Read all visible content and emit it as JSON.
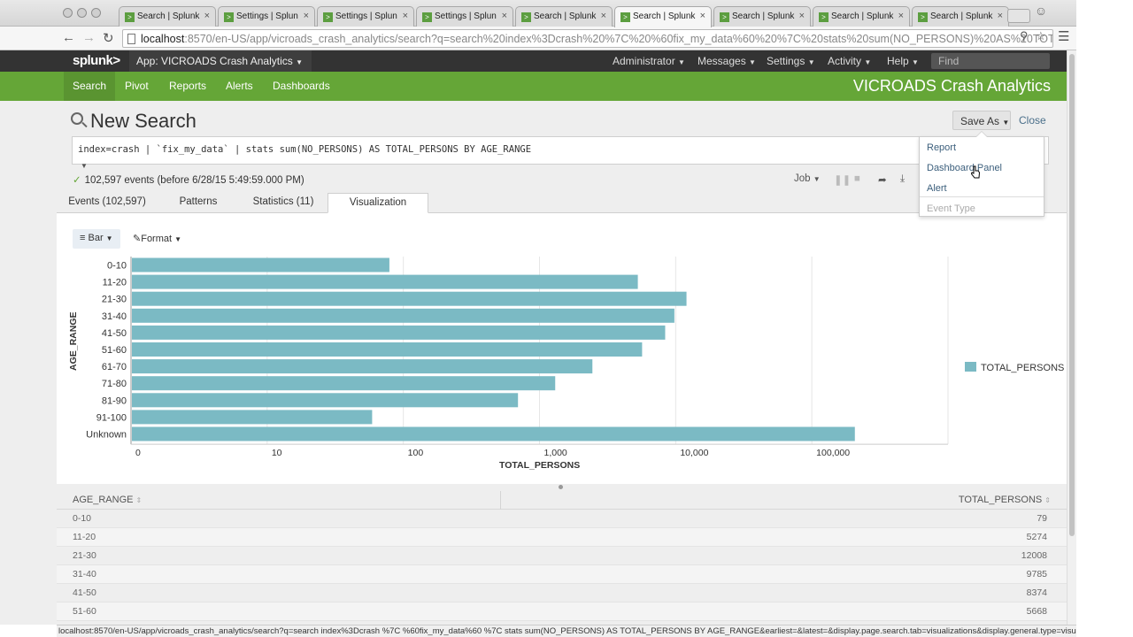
{
  "browser": {
    "tabs": [
      {
        "label": "Search | Splunk",
        "active": false
      },
      {
        "label": "Settings | Splun",
        "active": false
      },
      {
        "label": "Settings | Splun",
        "active": false
      },
      {
        "label": "Settings | Splun",
        "active": false
      },
      {
        "label": "Search | Splunk",
        "active": false
      },
      {
        "label": "Search | Splunk",
        "active": true
      },
      {
        "label": "Search | Splunk",
        "active": false
      },
      {
        "label": "Search | Splunk",
        "active": false
      },
      {
        "label": "Search | Splunk",
        "active": false
      }
    ],
    "tab_favicon": ">",
    "tab_close": "×",
    "url_host": "localhost",
    "url_rest": ":8570/en-US/app/vicroads_crash_analytics/search?q=search%20index%3Dcrash%20%7C%20%60fix_my_data%60%20%7C%20stats%20sum(NO_PERSONS)%20AS%20TOTAL_...",
    "status_url": "localhost:8570/en-US/app/vicroads_crash_analytics/search?q=search index%3Dcrash %7C %60fix_my_data%60 %7C stats sum(NO_PERSONS) AS TOTAL_PERSONS BY AGE_RANGE&earliest=&latest=&display.page.search.tab=visualizations&display.general.type=visualiz..."
  },
  "splunkbar": {
    "logo": "splunk>",
    "app_label": "App: VICROADS Crash Analytics",
    "items": [
      "Administrator",
      "Messages",
      "Settings",
      "Activity",
      "Help"
    ],
    "find_placeholder": "Find"
  },
  "appbar": {
    "nav": [
      "Search",
      "Pivot",
      "Reports",
      "Alerts",
      "Dashboards"
    ],
    "active": "Search",
    "title": "VICROADS Crash Analytics"
  },
  "search": {
    "title": "New Search",
    "save_as": "Save As",
    "close": "Close",
    "query": "index=crash | `fix_my_data` | stats sum(NO_PERSONS) AS TOTAL_PERSONS BY AGE_RANGE",
    "events_status": "102,597 events (before 6/28/15 5:49:59.000 PM)",
    "job_label": "Job"
  },
  "result_tabs": [
    {
      "label": "Events (102,597)",
      "active": false
    },
    {
      "label": "Patterns",
      "active": false
    },
    {
      "label": "Statistics (11)",
      "active": false
    },
    {
      "label": "Visualization",
      "active": true
    }
  ],
  "viz_controls": {
    "bar_label": "Bar",
    "format_label": "Format"
  },
  "save_menu": {
    "items": [
      {
        "label": "Report",
        "enabled": true
      },
      {
        "label": "Dashboard Panel",
        "enabled": true
      },
      {
        "label": "Alert",
        "enabled": true
      },
      {
        "label": "Event Type",
        "enabled": false
      }
    ]
  },
  "chart_data": {
    "type": "bar",
    "orientation": "horizontal",
    "x_scale": "log",
    "categories": [
      "0-10",
      "11-20",
      "21-30",
      "31-40",
      "41-50",
      "51-60",
      "61-70",
      "71-80",
      "81-90",
      "91-100",
      "Unknown"
    ],
    "series": [
      {
        "name": "TOTAL_PERSONS",
        "values": [
          79,
          5274,
          12008,
          9785,
          8374,
          5668,
          2446,
          1304,
          695,
          59,
          207000
        ]
      }
    ],
    "xlabel": "TOTAL_PERSONS",
    "ylabel": "AGE_RANGE",
    "x_ticks": [
      "0",
      "10",
      "100",
      "1,000",
      "10,000",
      "100,000"
    ],
    "xlim": [
      1,
      1000000
    ],
    "grid": true,
    "legend_position": "right",
    "bar_color": "#7bbac4"
  },
  "table": {
    "columns": [
      "AGE_RANGE",
      "TOTAL_PERSONS"
    ],
    "rows": [
      [
        "0-10",
        "79"
      ],
      [
        "11-20",
        "5274"
      ],
      [
        "21-30",
        "12008"
      ],
      [
        "31-40",
        "9785"
      ],
      [
        "41-50",
        "8374"
      ],
      [
        "51-60",
        "5668"
      ]
    ]
  },
  "colors": {
    "accent_green": "#65a637",
    "splunkbar": "#333333",
    "bar": "#7bbac4",
    "link": "#3c5f7c"
  }
}
